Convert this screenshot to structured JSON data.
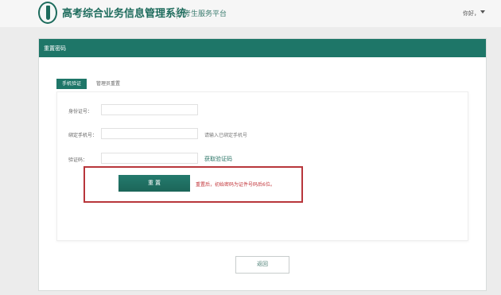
{
  "header": {
    "system_title": "高考综合业务信息管理系统",
    "platform": "考生服务平台",
    "greeting": "你好，"
  },
  "panel": {
    "title": "重置密码"
  },
  "tabs": [
    {
      "label": "手机验证",
      "active": true
    },
    {
      "label": "管理员重置",
      "active": false
    }
  ],
  "form": {
    "id_label": "身份证号：",
    "id_value": "",
    "phone_label": "绑定手机号：",
    "phone_value": "",
    "phone_hint": "请输入已绑定手机号",
    "code_label": "验证码：",
    "code_value": "",
    "get_code": "获取验证码",
    "reset_button": "重 置",
    "notice": "重置后，初始密码为证件号码后6位。"
  },
  "footer": {
    "back_button": "返回"
  },
  "colors": {
    "accent": "#1e7668",
    "notice_red": "#c2353a",
    "highlight_border": "#b8363b"
  }
}
